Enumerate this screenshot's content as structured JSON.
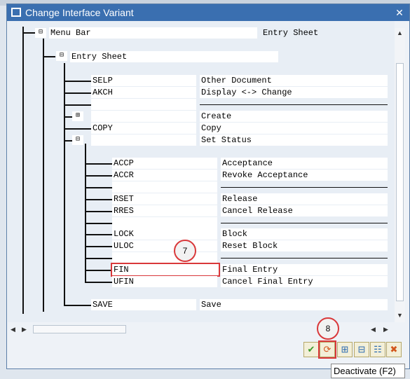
{
  "title": "Change Interface Variant",
  "menu_bar": {
    "label": "Menu Bar",
    "value": "Entry Sheet"
  },
  "entry_sheet": {
    "label": "Entry Sheet"
  },
  "rows1": [
    {
      "code": "SELP",
      "text": "Other Document"
    },
    {
      "code": "AKCH",
      "text": "Display <-> Change"
    },
    {
      "sep": true
    },
    {
      "code": "",
      "text": "Create",
      "icon": "folder-plus"
    },
    {
      "code": "COPY",
      "text": "Copy"
    },
    {
      "code": "",
      "text": "Set Status",
      "icon": "folder-minus"
    }
  ],
  "rows2": [
    {
      "code": "ACCP",
      "text": "Acceptance"
    },
    {
      "code": "ACCR",
      "text": "Revoke Acceptance"
    },
    {
      "sep": true
    },
    {
      "code": "RSET",
      "text": "Release"
    },
    {
      "code": "RRES",
      "text": "Cancel Release"
    },
    {
      "sep": true
    },
    {
      "code": "LOCK",
      "text": "Block"
    },
    {
      "code": "ULOC",
      "text": "Reset Block"
    },
    {
      "sep": true
    },
    {
      "code": "FIN",
      "text": "Final Entry",
      "highlight": true
    },
    {
      "code": "UFIN",
      "text": "Cancel Final Entry"
    }
  ],
  "save_row": {
    "code": "SAVE",
    "text": "Save"
  },
  "annotations": {
    "step7": "7",
    "step8": "8"
  },
  "tooltip": "Deactivate    (F2)",
  "toolbar": [
    "check-icon",
    "deactivate-icon",
    "expand-icon",
    "collapse-icon",
    "list-icon",
    "cancel-icon"
  ],
  "colors": {
    "title": "#3a6fb0",
    "highlight": "#d9383a"
  }
}
